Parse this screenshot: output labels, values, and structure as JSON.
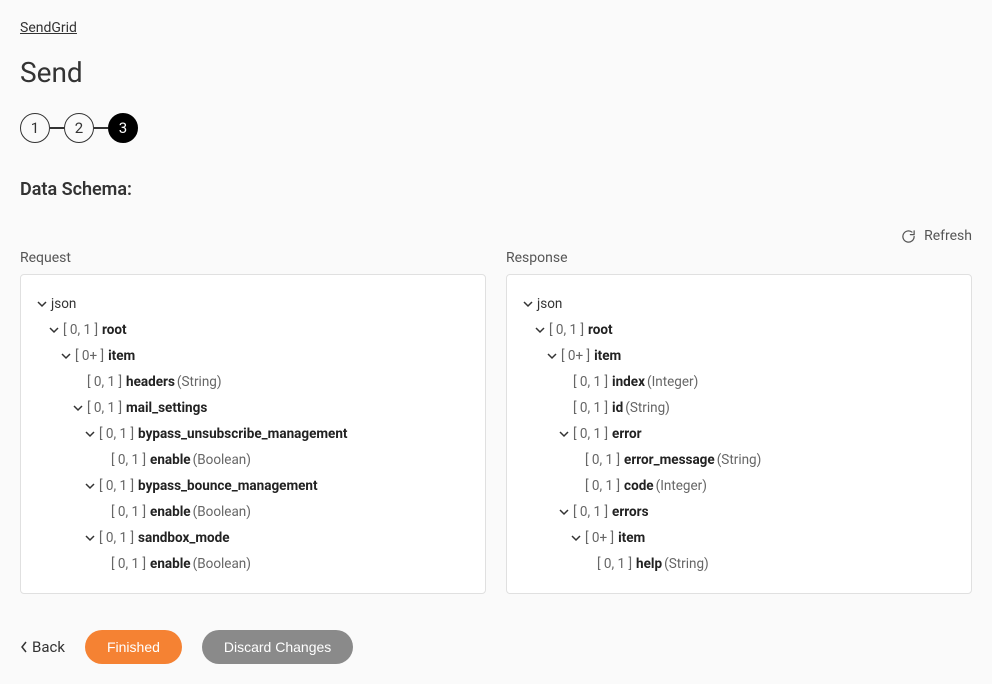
{
  "breadcrumb": "SendGrid",
  "page_title": "Send",
  "stepper": {
    "steps": [
      "1",
      "2",
      "3"
    ],
    "active_index": 2
  },
  "section_title": "Data Schema:",
  "refresh_label": "Refresh",
  "columns": {
    "request_label": "Request",
    "response_label": "Response"
  },
  "request_tree": [
    {
      "depth": 0,
      "chev": true,
      "card": "",
      "name": "json",
      "type": ""
    },
    {
      "depth": 1,
      "chev": true,
      "card": "[ 0, 1 ]",
      "name": "root",
      "type": ""
    },
    {
      "depth": 2,
      "chev": true,
      "card": "[ 0+ ]",
      "name": "item",
      "type": ""
    },
    {
      "depth": 3,
      "chev": false,
      "card": "[ 0, 1 ]",
      "name": "headers",
      "type": "(String)"
    },
    {
      "depth": 3,
      "chev": true,
      "card": "[ 0, 1 ]",
      "name": "mail_settings",
      "type": ""
    },
    {
      "depth": 4,
      "chev": true,
      "card": "[ 0, 1 ]",
      "name": "bypass_unsubscribe_management",
      "type": ""
    },
    {
      "depth": 5,
      "chev": false,
      "card": "[ 0, 1 ]",
      "name": "enable",
      "type": "(Boolean)"
    },
    {
      "depth": 4,
      "chev": true,
      "card": "[ 0, 1 ]",
      "name": "bypass_bounce_management",
      "type": ""
    },
    {
      "depth": 5,
      "chev": false,
      "card": "[ 0, 1 ]",
      "name": "enable",
      "type": "(Boolean)"
    },
    {
      "depth": 4,
      "chev": true,
      "card": "[ 0, 1 ]",
      "name": "sandbox_mode",
      "type": ""
    },
    {
      "depth": 5,
      "chev": false,
      "card": "[ 0, 1 ]",
      "name": "enable",
      "type": "(Boolean)"
    }
  ],
  "response_tree": [
    {
      "depth": 0,
      "chev": true,
      "card": "",
      "name": "json",
      "type": ""
    },
    {
      "depth": 1,
      "chev": true,
      "card": "[ 0, 1 ]",
      "name": "root",
      "type": ""
    },
    {
      "depth": 2,
      "chev": true,
      "card": "[ 0+ ]",
      "name": "item",
      "type": ""
    },
    {
      "depth": 3,
      "chev": false,
      "card": "[ 0, 1 ]",
      "name": "index",
      "type": "(Integer)"
    },
    {
      "depth": 3,
      "chev": false,
      "card": "[ 0, 1 ]",
      "name": "id",
      "type": "(String)"
    },
    {
      "depth": 3,
      "chev": true,
      "card": "[ 0, 1 ]",
      "name": "error",
      "type": ""
    },
    {
      "depth": 4,
      "chev": false,
      "card": "[ 0, 1 ]",
      "name": "error_message",
      "type": "(String)"
    },
    {
      "depth": 4,
      "chev": false,
      "card": "[ 0, 1 ]",
      "name": "code",
      "type": "(Integer)"
    },
    {
      "depth": 3,
      "chev": true,
      "card": "[ 0, 1 ]",
      "name": "errors",
      "type": ""
    },
    {
      "depth": 4,
      "chev": true,
      "card": "[ 0+ ]",
      "name": "item",
      "type": ""
    },
    {
      "depth": 5,
      "chev": false,
      "card": "[ 0, 1 ]",
      "name": "help",
      "type": "(String)"
    }
  ],
  "footer": {
    "back": "Back",
    "finished": "Finished",
    "discard": "Discard Changes"
  }
}
